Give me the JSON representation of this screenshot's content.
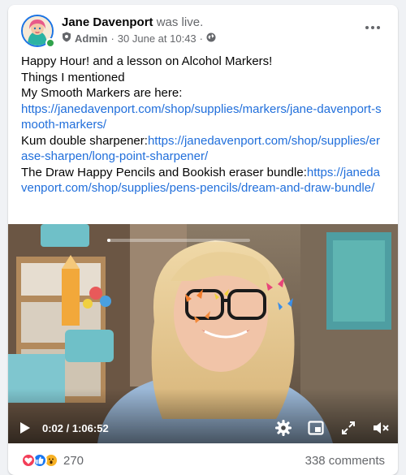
{
  "post": {
    "author": "Jane Davenport",
    "status": "was live.",
    "role": "Admin",
    "separator": "·",
    "timestamp": "30 June at 10:43",
    "separator2": "·",
    "audience_icon": "globe-icon",
    "more_icon": "more-options-icon",
    "lines": {
      "l1": "Happy Hour! and a lesson on Alcohol Markers!",
      "l2": "Things I mentioned",
      "l3": "My Smooth Markers are here:",
      "link1": "https://janedavenport.com/shop/supplies/markers/jane-davenport-smooth-markers/",
      "l4": "Kum double sharpener:",
      "link2": "https://janedavenport.com/shop/supplies/erase-sharpen/long-point-sharpener/",
      "l5": "The Draw Happy Pencils and Bookish eraser bundle:",
      "link3": "https://janedavenport.com/shop/supplies/pens-pencils/dream-and-draw-bundle/"
    }
  },
  "video": {
    "current_time": "0:02",
    "time_sep": " / ",
    "duration": "1:06:52",
    "progress_fraction": 0.01,
    "icons": [
      "play-icon",
      "settings-icon",
      "picture-in-picture-icon",
      "fullscreen-icon",
      "mute-icon"
    ]
  },
  "footer": {
    "reaction_count": "270",
    "comments": "338 comments",
    "reaction_icons": [
      "love-icon",
      "like-icon",
      "wow-icon"
    ]
  },
  "colors": {
    "link": "#216fdb",
    "secondary": "#65676b",
    "online": "#31a24c",
    "like": "#1877f2",
    "love": "#f33e58",
    "wow": "#f7b125"
  }
}
